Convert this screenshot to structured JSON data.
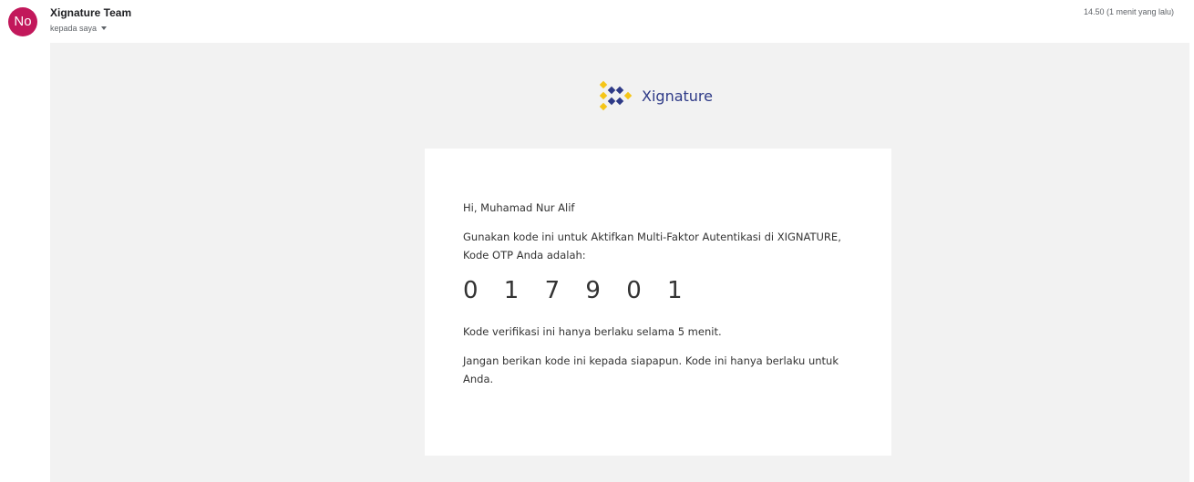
{
  "header": {
    "avatar_initials": "No",
    "avatar_color": "#c2185b",
    "sender_name": "Xignature Team",
    "recipient_label": "kepada saya",
    "timestamp": "14.50 (1 menit yang lalu)"
  },
  "email": {
    "logo_text": "Xignature",
    "logo_colors": {
      "yellow": "#f5c518",
      "navy": "#2e3a87"
    },
    "greeting": "Hi, Muhamad Nur Alif",
    "intro": "Gunakan kode ini untuk Aktifkan Multi-Faktor Autentikasi di XIGNATURE, Kode OTP Anda adalah:",
    "otp_code": "017901",
    "validity_note": "Kode verifikasi ini hanya berlaku selama 5 menit.",
    "warning_note": "Jangan berikan kode ini kepada siapapun. Kode ini hanya berlaku untuk Anda."
  }
}
